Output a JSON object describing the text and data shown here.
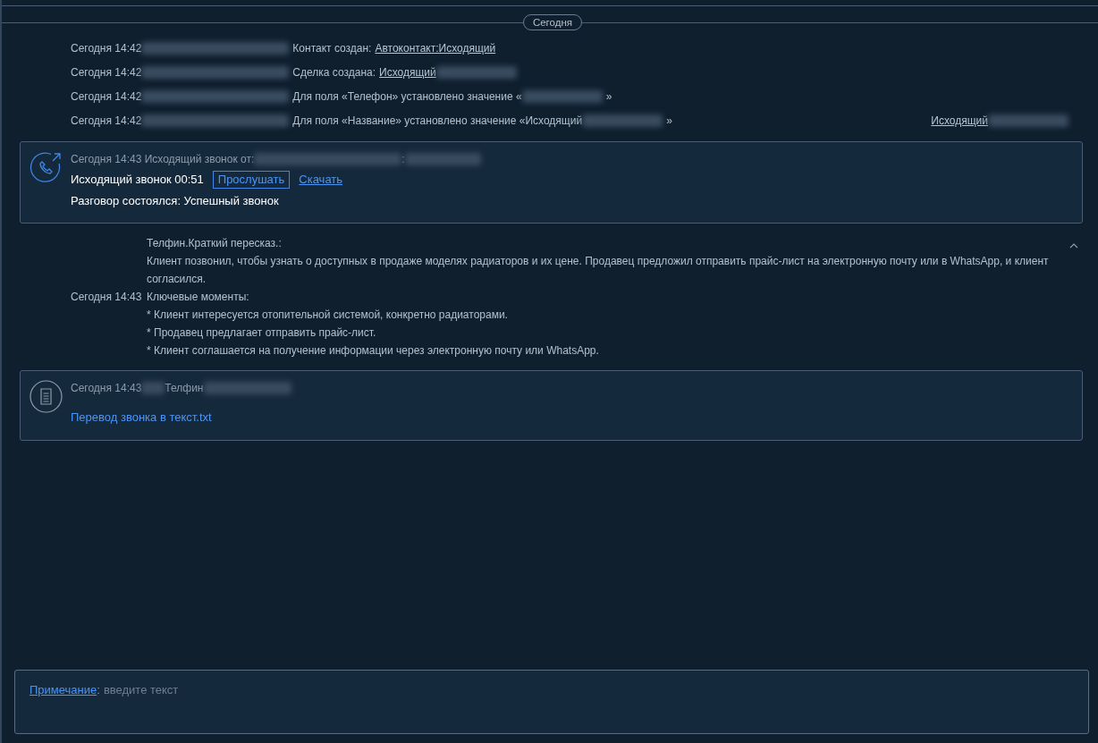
{
  "date_divider": "Сегодня",
  "events": [
    {
      "time": "Сегодня 14:42",
      "parts": [
        {
          "kind": "redacted"
        },
        {
          "kind": "text",
          "text": "Контакт создан:"
        },
        {
          "kind": "link",
          "text": "Автоконтакт:Исходящий"
        }
      ]
    },
    {
      "time": "Сегодня 14:42",
      "parts": [
        {
          "kind": "redacted"
        },
        {
          "kind": "text",
          "text": "Сделка создана:"
        },
        {
          "kind": "link",
          "text": "Исходящий"
        },
        {
          "kind": "redacted"
        }
      ]
    },
    {
      "time": "Сегодня 14:42",
      "parts": [
        {
          "kind": "redacted"
        },
        {
          "kind": "text",
          "text": "Для поля «Телефон» установлено значение «"
        },
        {
          "kind": "redacted"
        },
        {
          "kind": "text",
          "text": "»"
        }
      ]
    },
    {
      "time": "Сегодня 14:42",
      "parts": [
        {
          "kind": "redacted"
        },
        {
          "kind": "text",
          "text": "Для поля «Название» установлено значение «Исходящий"
        },
        {
          "kind": "redacted"
        },
        {
          "kind": "text",
          "text": "»"
        }
      ],
      "aside": [
        {
          "kind": "link",
          "text": "Исходящий"
        },
        {
          "kind": "redacted"
        }
      ]
    }
  ],
  "call": {
    "meta": "Сегодня 14:43 Исходящий звонок от:",
    "meta_sep": ":",
    "title": "Исходящий звонок 00:51",
    "listen": "Прослушать",
    "download": "Скачать",
    "result": "Разговор состоялся: Успешный звонок"
  },
  "summary": {
    "expanded": true,
    "heading": "Телфин.Краткий пересказ.:",
    "text": "Клиент позвонил, чтобы узнать о доступных в продаже моделях радиаторов и их цене. Продавец предложил отправить прайс-лист на электронную почту или в WhatsApp, и клиент согласился.",
    "time": "Сегодня 14:43",
    "points_heading": "Ключевые моменты:",
    "points": [
      "* Клиент интересуется отопительной системой, конкретно радиаторами.",
      "* Продавец предлагает отправить прайс-лист.",
      "* Клиент соглашается на получение информации через электронную почту или WhatsApp."
    ]
  },
  "file": {
    "time": "Сегодня 14:43",
    "author": "Телфин",
    "link": "Перевод звонка в текст.txt"
  },
  "note": {
    "label": "Примечание",
    "separator": ":",
    "placeholder": "введите текст"
  }
}
